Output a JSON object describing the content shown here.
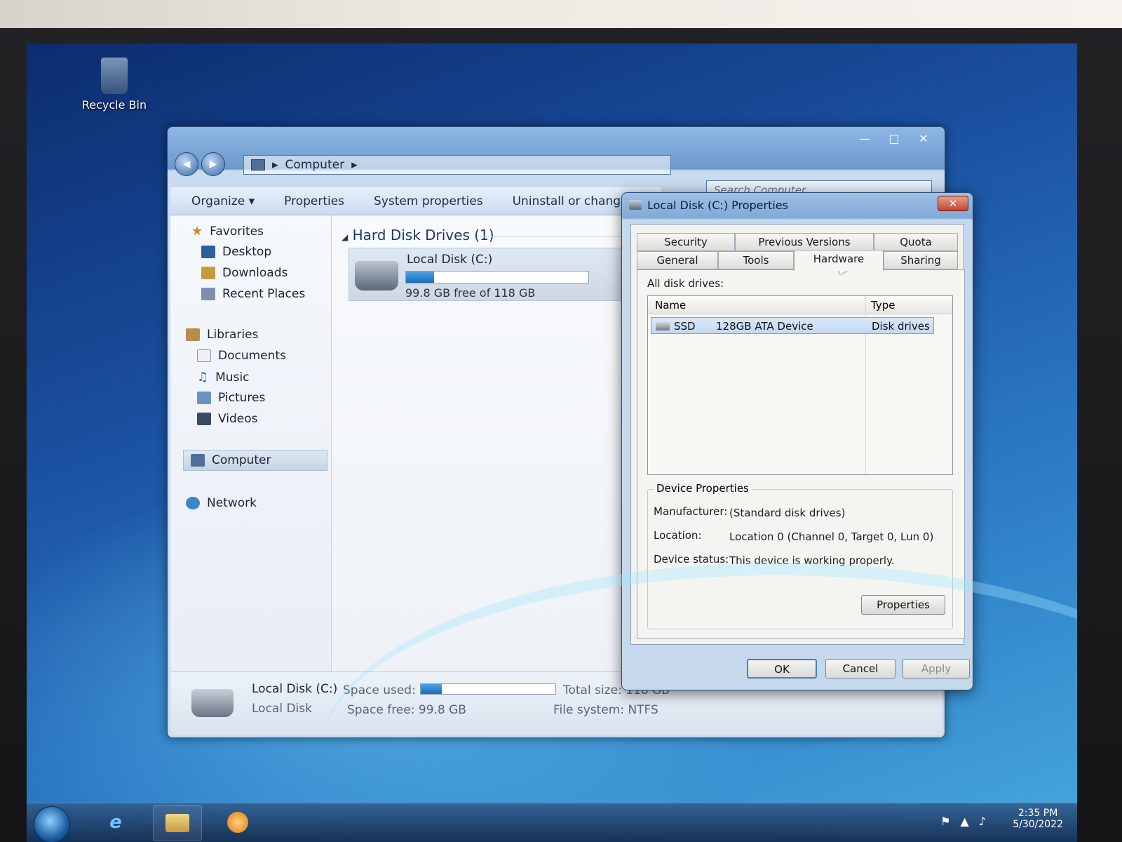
{
  "desktop": {
    "icons": [
      {
        "label": "Recycle Bin",
        "icon": "recycle-bin-icon"
      }
    ]
  },
  "explorer": {
    "address": {
      "crumb": "Computer",
      "search_placeholder": "Search Computer"
    },
    "toolbar": {
      "organize_label": "Organize",
      "properties_label": "Properties",
      "system_properties_label": "System properties",
      "uninstall_label": "Uninstall or change"
    },
    "nav": {
      "favorites": {
        "label": "Favorites",
        "items": [
          "Desktop",
          "Downloads",
          "Recent Places"
        ]
      },
      "libraries": {
        "label": "Libraries",
        "items": [
          "Documents",
          "Music",
          "Pictures",
          "Videos"
        ]
      },
      "computer": "Computer",
      "network": "Network"
    },
    "content": {
      "group_title": "Hard Disk Drives (1)",
      "drive": {
        "name": "Local Disk (C:)",
        "free_text": "99.8 GB free of 118 GB",
        "used_fraction": 0.154
      }
    },
    "details": {
      "name": "Local Disk (C:)",
      "type": "Local Disk",
      "space_used_label": "Space used:",
      "space_free_label": "Space free:",
      "space_free_value": "99.8 GB",
      "total_size_label": "Total size:",
      "total_size_value": "118 GB",
      "file_system_label": "File system:",
      "file_system_value": "NTFS",
      "used_fraction": 0.154
    }
  },
  "dialog": {
    "title": "Local Disk (C:) Properties",
    "close_label": "✕",
    "tabs_row1": [
      "Security",
      "Previous Versions",
      "Quota"
    ],
    "tabs_row2": [
      "General",
      "Tools",
      "Hardware",
      "Sharing"
    ],
    "active_tab": "Hardware",
    "all_disk_drives_label": "All disk drives:",
    "columns": [
      "Name",
      "Type"
    ],
    "rows": [
      {
        "name": "SSD",
        "model": "128GB ATA Device",
        "type": "Disk drives"
      }
    ],
    "device_properties": {
      "title": "Device Properties",
      "manufacturer_label": "Manufacturer:",
      "manufacturer_value": "(Standard disk drives)",
      "location_label": "Location:",
      "location_value": "Location 0 (Channel 0, Target 0, Lun 0)",
      "status_label": "Device status:",
      "status_value": "This device is working properly.",
      "properties_button": "Properties"
    },
    "buttons": {
      "ok": "OK",
      "cancel": "Cancel",
      "apply": "Apply"
    }
  },
  "taskbar": {
    "clock_time": "2:35 PM",
    "clock_date": "5/30/2022"
  }
}
